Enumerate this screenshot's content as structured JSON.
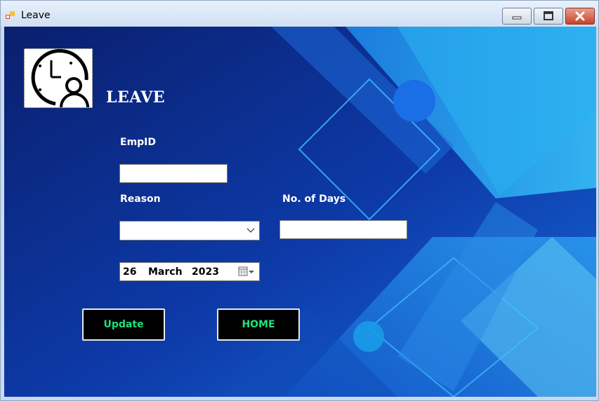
{
  "window": {
    "title": "Leave",
    "icon": "app-form-icon",
    "controls": [
      "minimize-icon",
      "maximize-icon",
      "close-icon"
    ]
  },
  "form": {
    "heading": "LEAVE",
    "logo_icon": "clock-person-icon",
    "empid_label": "EmpID",
    "empid_value": "",
    "reason_label": "Reason",
    "reason_value": "",
    "days_label": "No. of Days",
    "days_value": "",
    "date": {
      "day": "26",
      "month": "March",
      "year": "2023"
    },
    "update_label": "Update",
    "home_label": "HOME"
  },
  "colors": {
    "background_dark": "#0b2a8a",
    "background_light": "#1e9be0",
    "button_text": "#1ee27a",
    "button_bg": "#000000"
  }
}
